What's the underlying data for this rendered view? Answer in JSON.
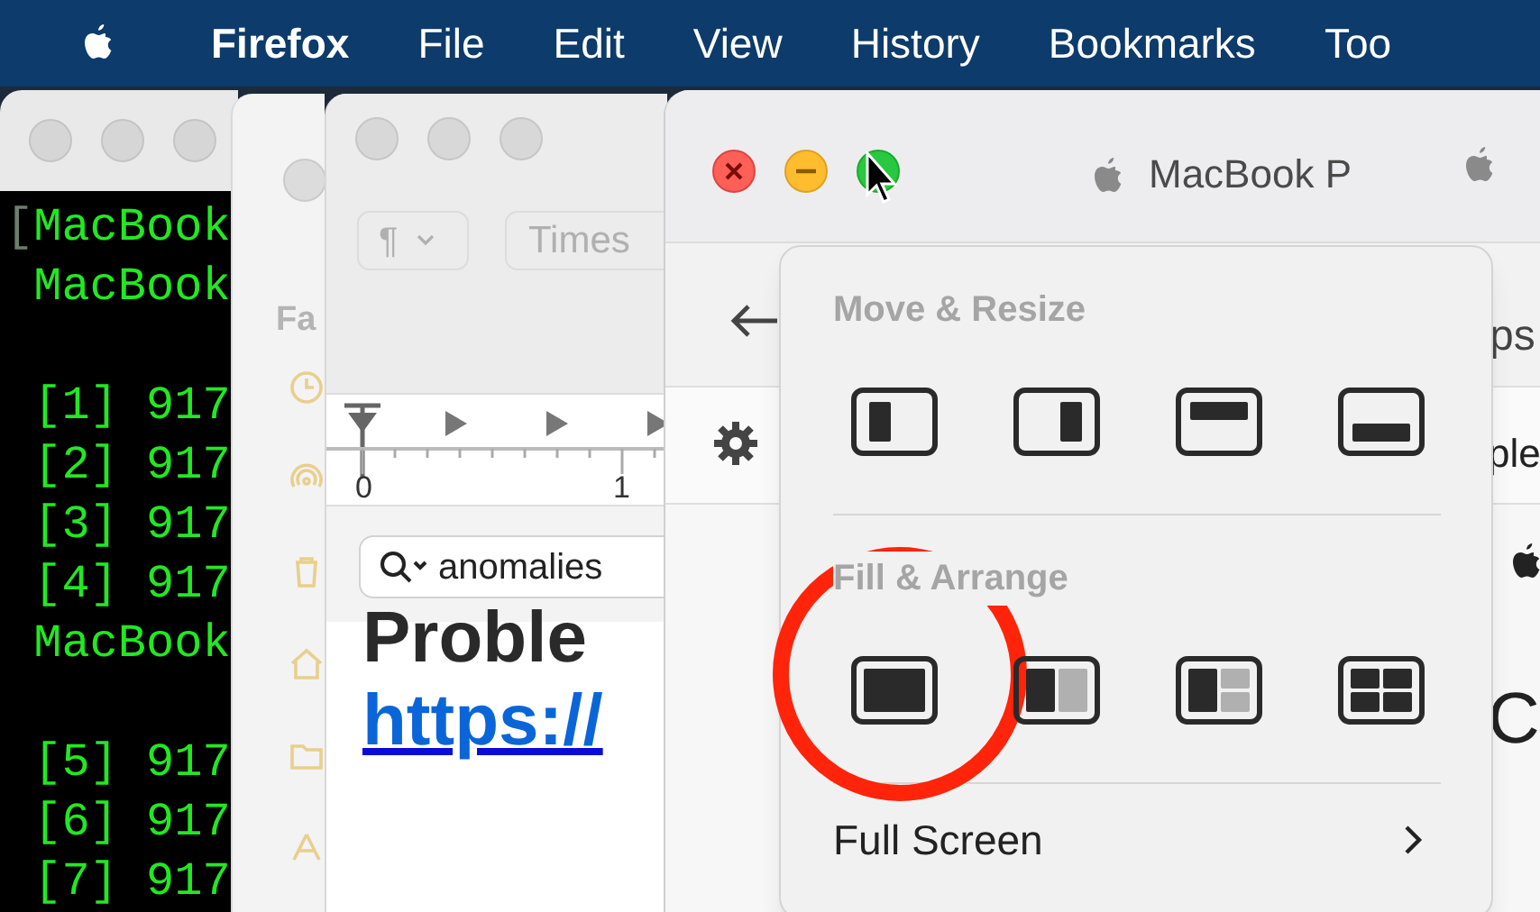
{
  "menu_bar": {
    "app": "Firefox",
    "items": [
      "File",
      "Edit",
      "View",
      "History",
      "Bookmarks",
      "Too"
    ]
  },
  "terminal": {
    "lines": [
      {
        "kind": "prompt",
        "bracket": "[",
        "text": "MacBook"
      },
      {
        "kind": "text",
        "text": "MacBook"
      },
      {
        "kind": "blank"
      },
      {
        "kind": "text",
        "text": "[1] 917"
      },
      {
        "kind": "text",
        "text": "[2] 917"
      },
      {
        "kind": "text",
        "text": "[3] 917"
      },
      {
        "kind": "text",
        "text": "[4] 917"
      },
      {
        "kind": "text",
        "text": "MacBook"
      },
      {
        "kind": "blank"
      },
      {
        "kind": "text",
        "text": "[5] 917"
      },
      {
        "kind": "text",
        "text": "[6] 917"
      },
      {
        "kind": "text",
        "text": "[7] 917"
      }
    ]
  },
  "finder": {
    "sidebar_heading": "Fa"
  },
  "textedit": {
    "paragraph_style": "¶",
    "font": "Times",
    "ruler_labels": [
      "0",
      "1"
    ],
    "search": {
      "value": "anomalies"
    },
    "heading": "Proble",
    "link": "https://"
  },
  "browser": {
    "tabs": [
      "MacBook P"
    ],
    "edge_texts": [
      "ps",
      "ple",
      "C"
    ]
  },
  "window_menu": {
    "sections": [
      {
        "title": "Move & Resize",
        "layouts": [
          {
            "kind": "left",
            "circled": false
          },
          {
            "kind": "right",
            "circled": false
          },
          {
            "kind": "top",
            "circled": false
          },
          {
            "kind": "bottom",
            "circled": false
          }
        ]
      },
      {
        "title": "Fill & Arrange",
        "layouts": [
          {
            "kind": "fill",
            "circled": true
          },
          {
            "kind": "split",
            "circled": false
          },
          {
            "kind": "triple",
            "circled": false
          },
          {
            "kind": "quad",
            "circled": false
          }
        ]
      }
    ],
    "items": [
      {
        "label": "Full Screen",
        "submenu": true
      }
    ]
  }
}
